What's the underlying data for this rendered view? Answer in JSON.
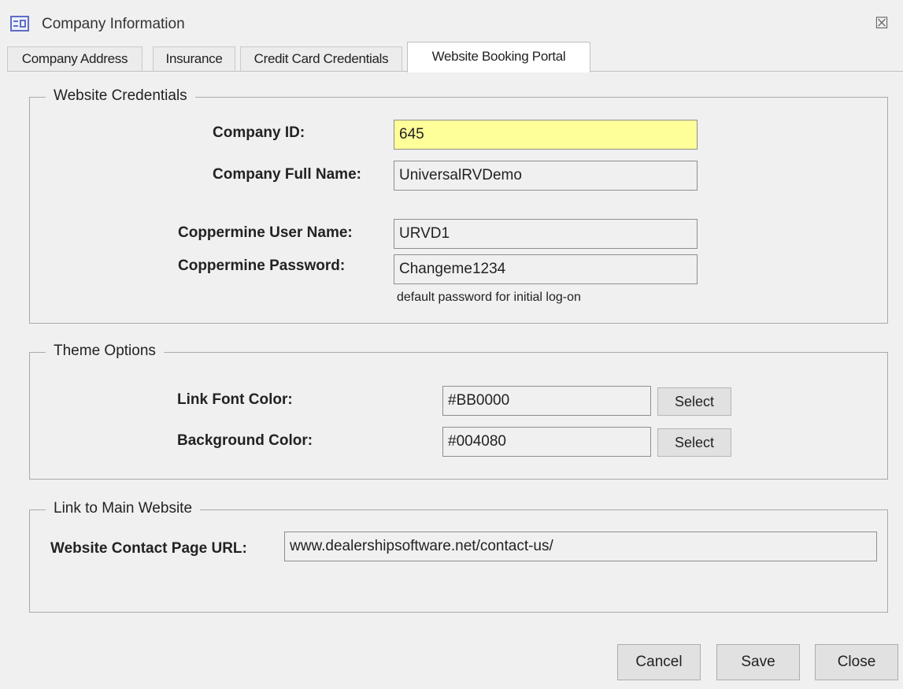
{
  "window": {
    "title": "Company Information",
    "close_glyph": "☒"
  },
  "tabs": [
    {
      "label": "Company Address"
    },
    {
      "label": "Insurance"
    },
    {
      "label": "Credit Card Credentials"
    },
    {
      "label": "Website Booking Portal",
      "active": true
    }
  ],
  "website_credentials": {
    "title": "Website Credentials",
    "company_id_label": "Company ID:",
    "company_id_value": "645",
    "company_full_name_label": "Company Full Name:",
    "company_full_name_value": "UniversalRVDemo",
    "user_name_label": "Coppermine User Name:",
    "user_name_value": "URVD1",
    "password_label": "Coppermine Password:",
    "password_value": "Changeme1234",
    "password_note": "default password for initial log-on"
  },
  "theme_options": {
    "title": "Theme Options",
    "link_font_color_label": "Link Font Color:",
    "link_font_color_value": "#BB0000",
    "background_color_label": "Background Color:",
    "background_color_value": "#004080",
    "select_label": "Select"
  },
  "main_website": {
    "title": "Link to Main Website",
    "contact_url_label": "Website Contact Page URL:",
    "contact_url_value": "www.dealershipsoftware.net/contact-us/"
  },
  "footer": {
    "cancel_label": "Cancel",
    "save_label": "Save",
    "close_label": "Close"
  },
  "colors": {
    "highlight_field": "#ffff99",
    "icon_blue": "#5d6ec6"
  }
}
